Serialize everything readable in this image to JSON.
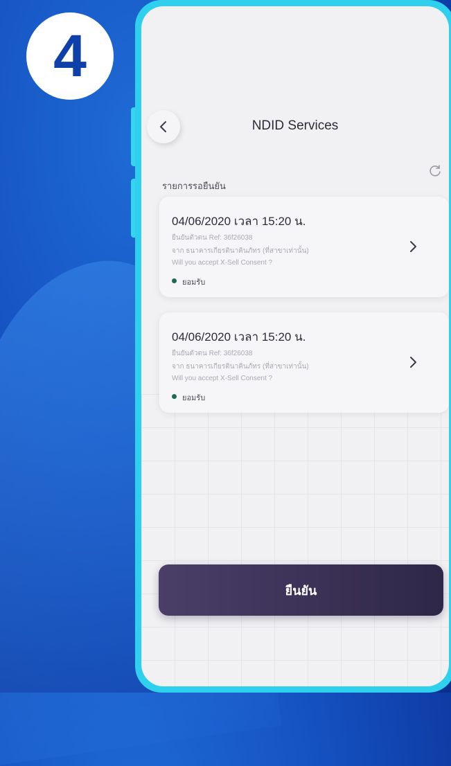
{
  "step_number": "4",
  "header": {
    "title": "NDID Services"
  },
  "section": {
    "label": "รายการรอยืนยัน"
  },
  "requests": [
    {
      "datetime": "04/06/2020 เวลา 15:20 น.",
      "ref_line": "ยืนยันตัวตน Ref: 36f26038",
      "from_line": "จาก ธนาคารเกียรตินาคินภัทร (ที่สาขาเท่านั้น)",
      "question": "Will you accept X-Sell Consent ?",
      "status": "ยอมรับ"
    },
    {
      "datetime": "04/06/2020 เวลา 15:20 น.",
      "ref_line": "ยืนยันตัวตน Ref: 36f26038",
      "from_line": "จาก ธนาคารเกียรตินาคินภัทร (ที่สาขาเท่านั้น)",
      "question": "Will you accept X-Sell Consent ?",
      "status": "ยอมรับ"
    }
  ],
  "confirm_button": {
    "label": "ยืนยัน"
  },
  "icons": {
    "back": "chevron-left-icon",
    "refresh": "refresh-icon",
    "next": "chevron-right-icon"
  },
  "colors": {
    "frame": "#2ed0ee",
    "confirm_bg": "#3d3358",
    "status_dot": "#1f6b4f",
    "background": "#1553c2"
  }
}
